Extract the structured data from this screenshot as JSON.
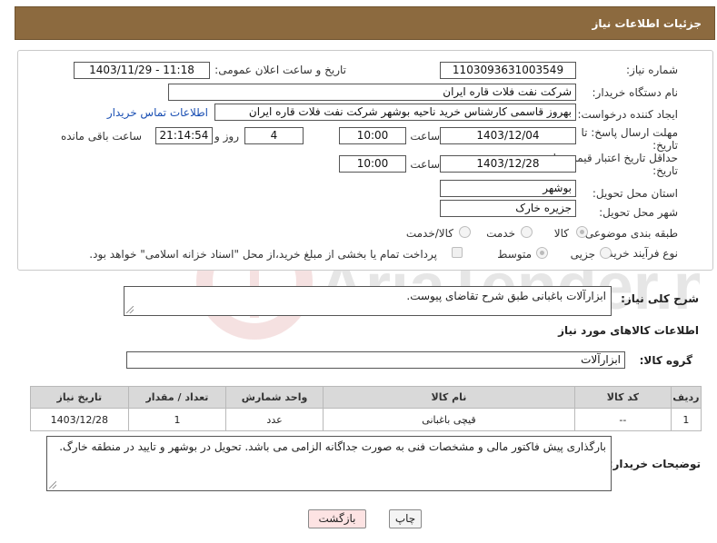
{
  "header": {
    "title": "جزئیات اطلاعات نیاز"
  },
  "form": {
    "need_number_label": "شماره نیاز:",
    "need_number": "1103093631003549",
    "announce_label": "تاریخ و ساعت اعلان عمومی:",
    "announce_value": "1403/11/29 - 11:18",
    "buyer_org_label": "نام دستگاه خریدار:",
    "buyer_org": "شرکت نفت فلات قاره ایران",
    "creator_label": "ایجاد کننده درخواست:",
    "creator": "بهروز قاسمی کارشناس خرید ناحیه بوشهر شرکت نفت فلات قاره ایران",
    "contact_link": "اطلاعات تماس خریدار",
    "deadline_label": "مهلت ارسال پاسخ: تا تاریخ:",
    "deadline_date": "1403/12/04",
    "time_label": "ساعت",
    "deadline_time": "10:00",
    "days": "4",
    "days_suffix": "روز و",
    "remaining": "21:14:54",
    "remaining_suffix": "ساعت باقی مانده",
    "validity_label": "حداقل تاریخ اعتبار قیمت: تا تاریخ:",
    "validity_date": "1403/12/28",
    "validity_time_label": "ساعت",
    "validity_time": "10:00",
    "province_label": "استان محل تحویل:",
    "province": "بوشهر",
    "city_label": "شهر محل تحویل:",
    "city": "جزیره خارک",
    "category_label": "طبقه بندی موضوعی:",
    "cat_goods": "کالا",
    "cat_service": "خدمت",
    "cat_both": "کالا/خدمت",
    "process_label": "نوع فرآیند خرید :",
    "proc_small": "جزیی",
    "proc_medium": "متوسط",
    "payment_note": "پرداخت تمام یا بخشی از مبلغ خرید،از محل \"اسناد خزانه اسلامی\" خواهد بود."
  },
  "description": {
    "label": "شرح کلی نیاز:",
    "value": "ابزارآلات باغبانی طبق شرح تقاضای پیوست."
  },
  "goods_section": {
    "title": "اطلاعات کالاهای مورد نیاز"
  },
  "goods_group": {
    "label": "گروه کالا:",
    "value": "ابزارآلات"
  },
  "table": {
    "headers": [
      "ردیف",
      "کد کالا",
      "نام کالا",
      "واحد شمارش",
      "تعداد / مقدار",
      "تاریخ نیاز"
    ],
    "rows": [
      [
        "1",
        "--",
        "قیچی باغبانی",
        "عدد",
        "1",
        "1403/12/28"
      ]
    ]
  },
  "buyer_notes": {
    "label": "توضیحات خریدار:",
    "value": "بارگذاری پیش فاکتور مالی و مشخصات فنی  به صورت جداگانه الزامی می باشد. تحویل در بوشهر و تایید در منطقه خارگ."
  },
  "buttons": {
    "print": "چاپ",
    "back": "بازگشت"
  },
  "watermark": {
    "text": "AriaTender.neT"
  },
  "colors": {
    "header_bg": "#8c6a3f",
    "link": "#1a4fb3",
    "back_button_bg": "#fde3e3"
  }
}
